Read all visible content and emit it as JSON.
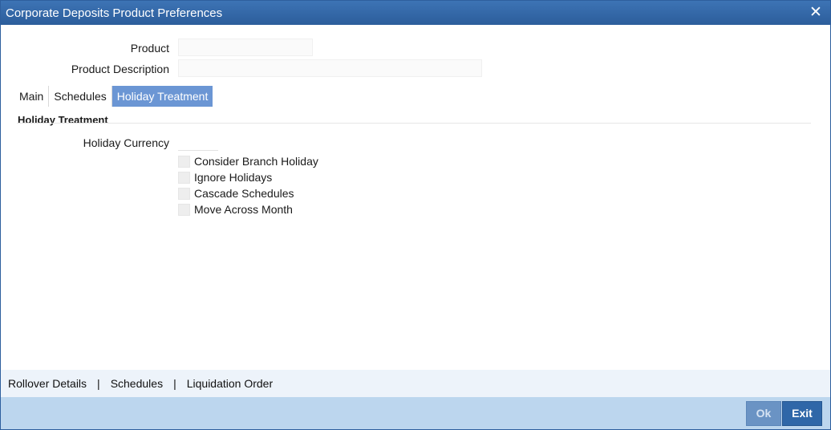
{
  "window": {
    "title": "Corporate Deposits Product Preferences",
    "close_glyph": "✕"
  },
  "header_fields": {
    "product_label": "Product",
    "product_value": "",
    "product_description_label": "Product Description",
    "product_description_value": ""
  },
  "tabs": [
    {
      "label": "Main",
      "active": false
    },
    {
      "label": "Schedules",
      "active": false
    },
    {
      "label": "Holiday Treatment",
      "active": true
    }
  ],
  "holiday_treatment": {
    "section_title": "Holiday Treatment",
    "holiday_currency_label": "Holiday Currency",
    "holiday_currency_value": "",
    "checkboxes": [
      {
        "label": "Consider Branch Holiday",
        "checked": false
      },
      {
        "label": "Ignore Holidays",
        "checked": false
      },
      {
        "label": "Cascade Schedules",
        "checked": false
      },
      {
        "label": "Move Across Month",
        "checked": false
      }
    ]
  },
  "bottom_links": {
    "rollover_details": "Rollover Details",
    "schedules": "Schedules",
    "liquidation_order": "Liquidation Order",
    "separator": "|"
  },
  "footer": {
    "ok_label": "Ok",
    "exit_label": "Exit"
  },
  "colors": {
    "titlebar": "#2c5d9b",
    "active_tab": "#6b96d4",
    "footer_band": "#bcd6ee",
    "link_band": "#edf3fa",
    "button": "#2f67a8"
  },
  "icons": {
    "close": "close-icon"
  }
}
